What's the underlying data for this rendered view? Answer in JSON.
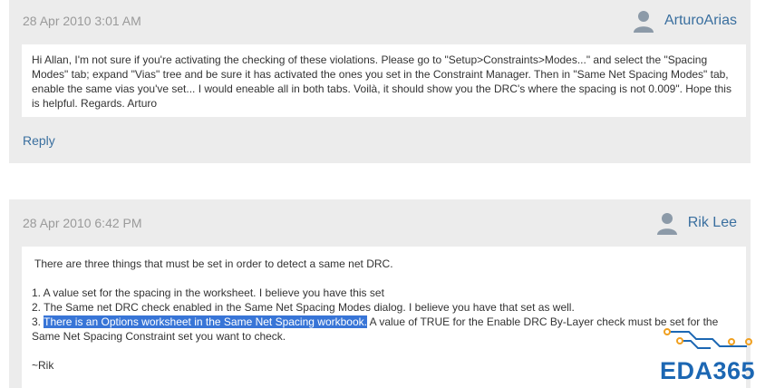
{
  "posts": [
    {
      "date": "28 Apr 2010 3:01 AM",
      "author": "ArturoArias",
      "body": "Hi Allan, I'm not sure if you're activating the checking of these violations. Please go to \"Setup>Constraints>Modes...\" and select the \"Spacing Modes\" tab; expand \"Vias\" tree and be sure it has activated the ones you set in the Constraint Manager. Then in \"Same Net Spacing Modes\" tab, enable the same vias you've set... I would eneable all in both tabs. Voilà, it should show you the DRC's where the spacing is not 0.009\". Hope this is helpful. Regards. Arturo",
      "reply_label": "Reply"
    },
    {
      "date": "28 Apr 2010 6:42 PM",
      "author": "Rik Lee",
      "intro": "There are three things that must be set in order to detect a same net DRC.",
      "item1": "1. A value set for the spacing in the worksheet. I believe you have this set",
      "item2": "2. The Same net DRC check enabled in the Same Net Spacing Modes dialog. I believe you have that set as well.",
      "item3_prefix": "3. ",
      "item3_highlight": "There is an Options worksheet in the Same Net Spacing workbook.",
      "item3_rest": " A value of TRUE for the Enable DRC By-Layer check must be set for the Same Net Spacing Constraint set you want to check.",
      "signoff": "~Rik"
    }
  ],
  "logo": {
    "text": "EDA365",
    "color": "#1c67b3",
    "trace_color": "#1c67b3",
    "node_color": "#f0a020"
  },
  "colors": {
    "link": "#3a6f9f",
    "selection": "#3875d7",
    "card_bg": "#ececec"
  }
}
